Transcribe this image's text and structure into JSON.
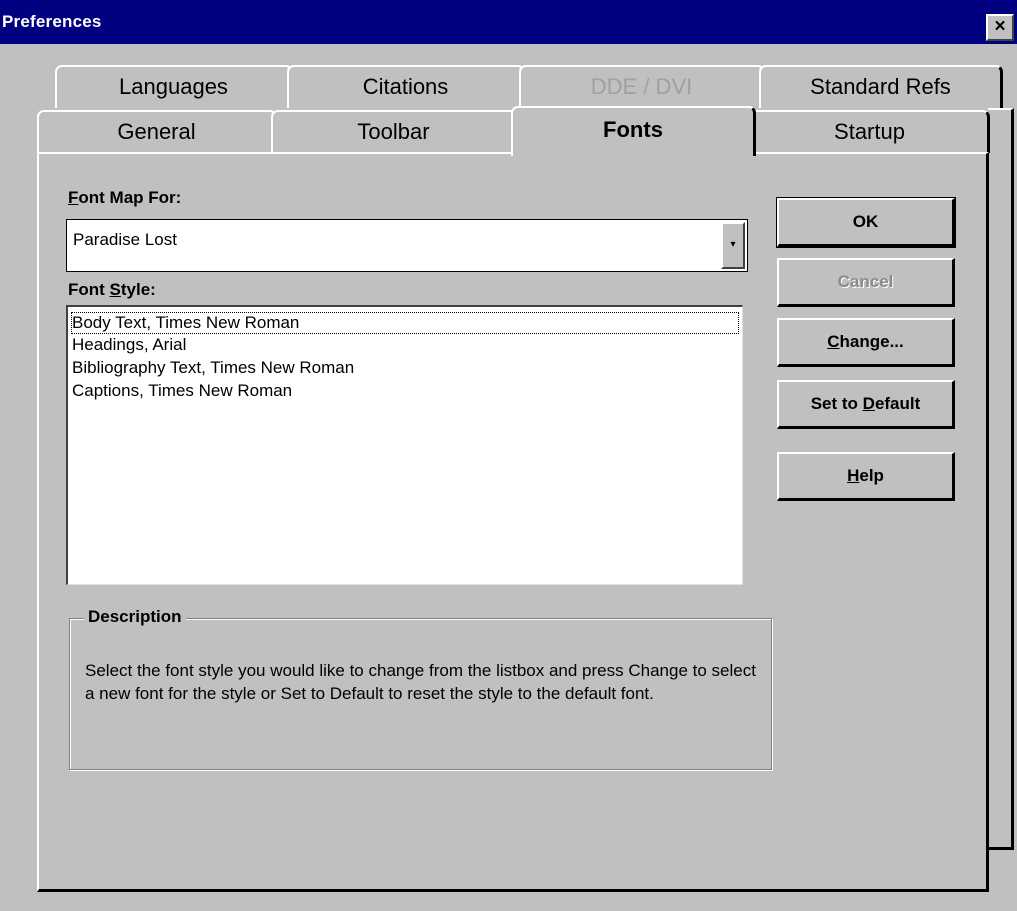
{
  "window": {
    "title": "Preferences",
    "close_glyph": "×"
  },
  "tabs": {
    "row_back": [
      "Languages",
      "Citations",
      "DDE / DVI",
      "Standard Refs"
    ],
    "row_front": [
      "General",
      "Toolbar",
      "Fonts",
      "Startup"
    ],
    "active": "Fonts",
    "disabled": [
      "DDE / DVI"
    ]
  },
  "font_map": {
    "label_prefix": "",
    "label_accel": "F",
    "label_rest": "ont Map For:",
    "value": "Paradise Lost",
    "dropdown_icon": "▾"
  },
  "font_style": {
    "label_prefix": "Font ",
    "label_accel": "S",
    "label_rest": "tyle:",
    "items": [
      "Body Text, Times New Roman",
      "Headings, Arial",
      "Bibliography Text, Times New Roman",
      "Captions, Times New Roman"
    ]
  },
  "buttons": {
    "ok": "OK",
    "cancel": "Cancel",
    "change_accel": "C",
    "change_rest": "hange...",
    "default_prefix": "Set to ",
    "default_accel": "D",
    "default_rest": "efault",
    "help_accel": "H",
    "help_rest": "elp"
  },
  "description": {
    "legend": "Description",
    "text": "Select the font style you would like to change from the listbox and press Change to select a new font for the style or Set to Default to reset the style to the default font."
  }
}
